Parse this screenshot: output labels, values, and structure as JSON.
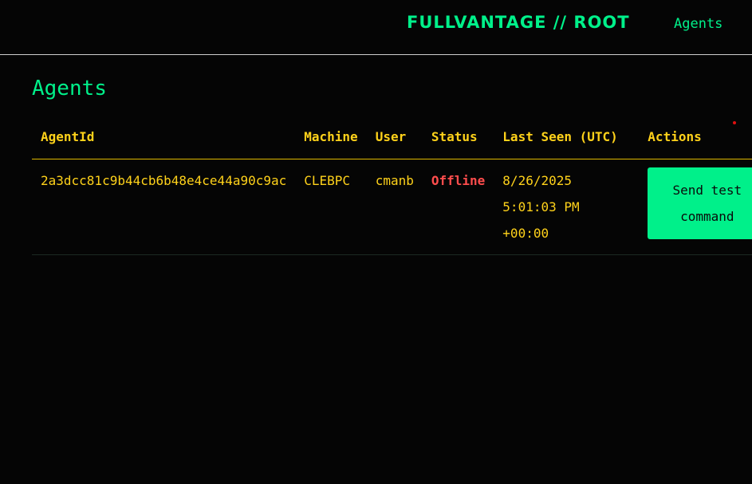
{
  "header": {
    "brand": "FULLVANTAGE // ROOT",
    "nav_agents": "Agents"
  },
  "page": {
    "title": "Agents"
  },
  "table": {
    "columns": [
      "AgentId",
      "Machine",
      "User",
      "Status",
      "Last Seen (UTC)",
      "Actions"
    ],
    "rows": [
      {
        "agent_id": "2a3dcc81c9b44cb6b48e4ce44a90c9ac",
        "machine": "CLEBPC",
        "user": "cmanb",
        "status": "Offline",
        "last_seen": "8/26/2025 5:01:03 PM +00:00",
        "action_label": "Send test command"
      }
    ]
  },
  "colors": {
    "background": "#050505",
    "accent_green": "#00f08a",
    "accent_yellow": "#ffd21a",
    "status_offline": "#ff4d4d"
  }
}
